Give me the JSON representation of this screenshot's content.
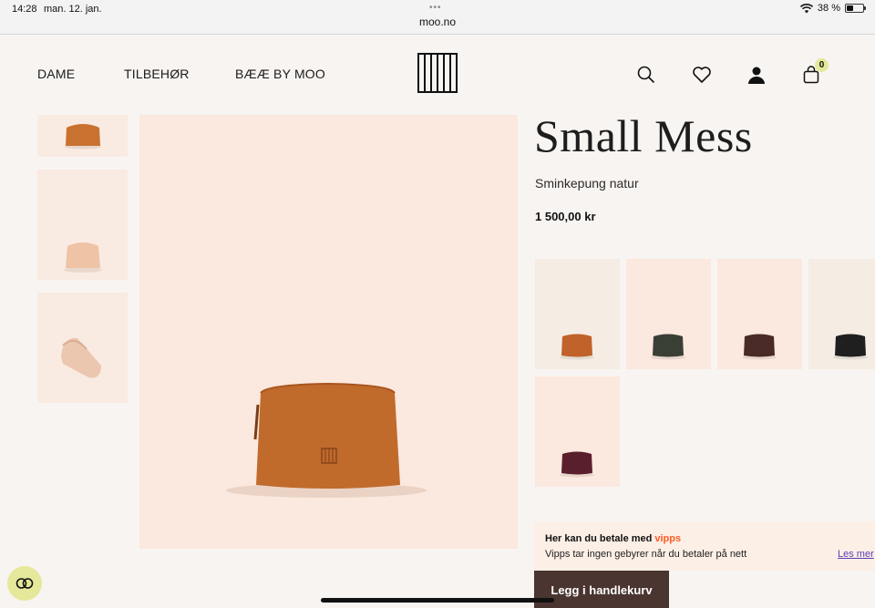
{
  "status_bar": {
    "time": "14:28",
    "date": "man. 12. jan.",
    "url": "moo.no",
    "battery_text": "38 %",
    "battery_level": 0.38
  },
  "header": {
    "nav": [
      "DAME",
      "TILBEHØR",
      "BÆÆ BY MOO"
    ],
    "logo_text": "MOO",
    "cart_count": "0"
  },
  "product": {
    "title": "Small Mess",
    "subtitle": "Sminkepung natur",
    "price": "1 500,00 kr"
  },
  "variants": {
    "colors": [
      "#c0622a",
      "#3a3f36",
      "#4a2a26",
      "#1f1f1f",
      "#5a1f2c"
    ],
    "backgrounds": [
      "#f5ece3",
      "#fbe8de",
      "#fbe8de",
      "#f5ece3",
      "#fbe8de"
    ]
  },
  "vipps": {
    "line1": "Her kan du betale med",
    "logo": "vipps",
    "line2": "Vipps tar ingen gebyrer når du betaler på nett",
    "more": "Les mer"
  },
  "actions": {
    "add_to_cart": "Legg i handlekurv"
  },
  "colors": {
    "page_bg": "#f8f4f1",
    "accent_yellow": "#e5e89a",
    "button_bg": "#4a3530",
    "vipps_orange": "#ff5b24"
  }
}
